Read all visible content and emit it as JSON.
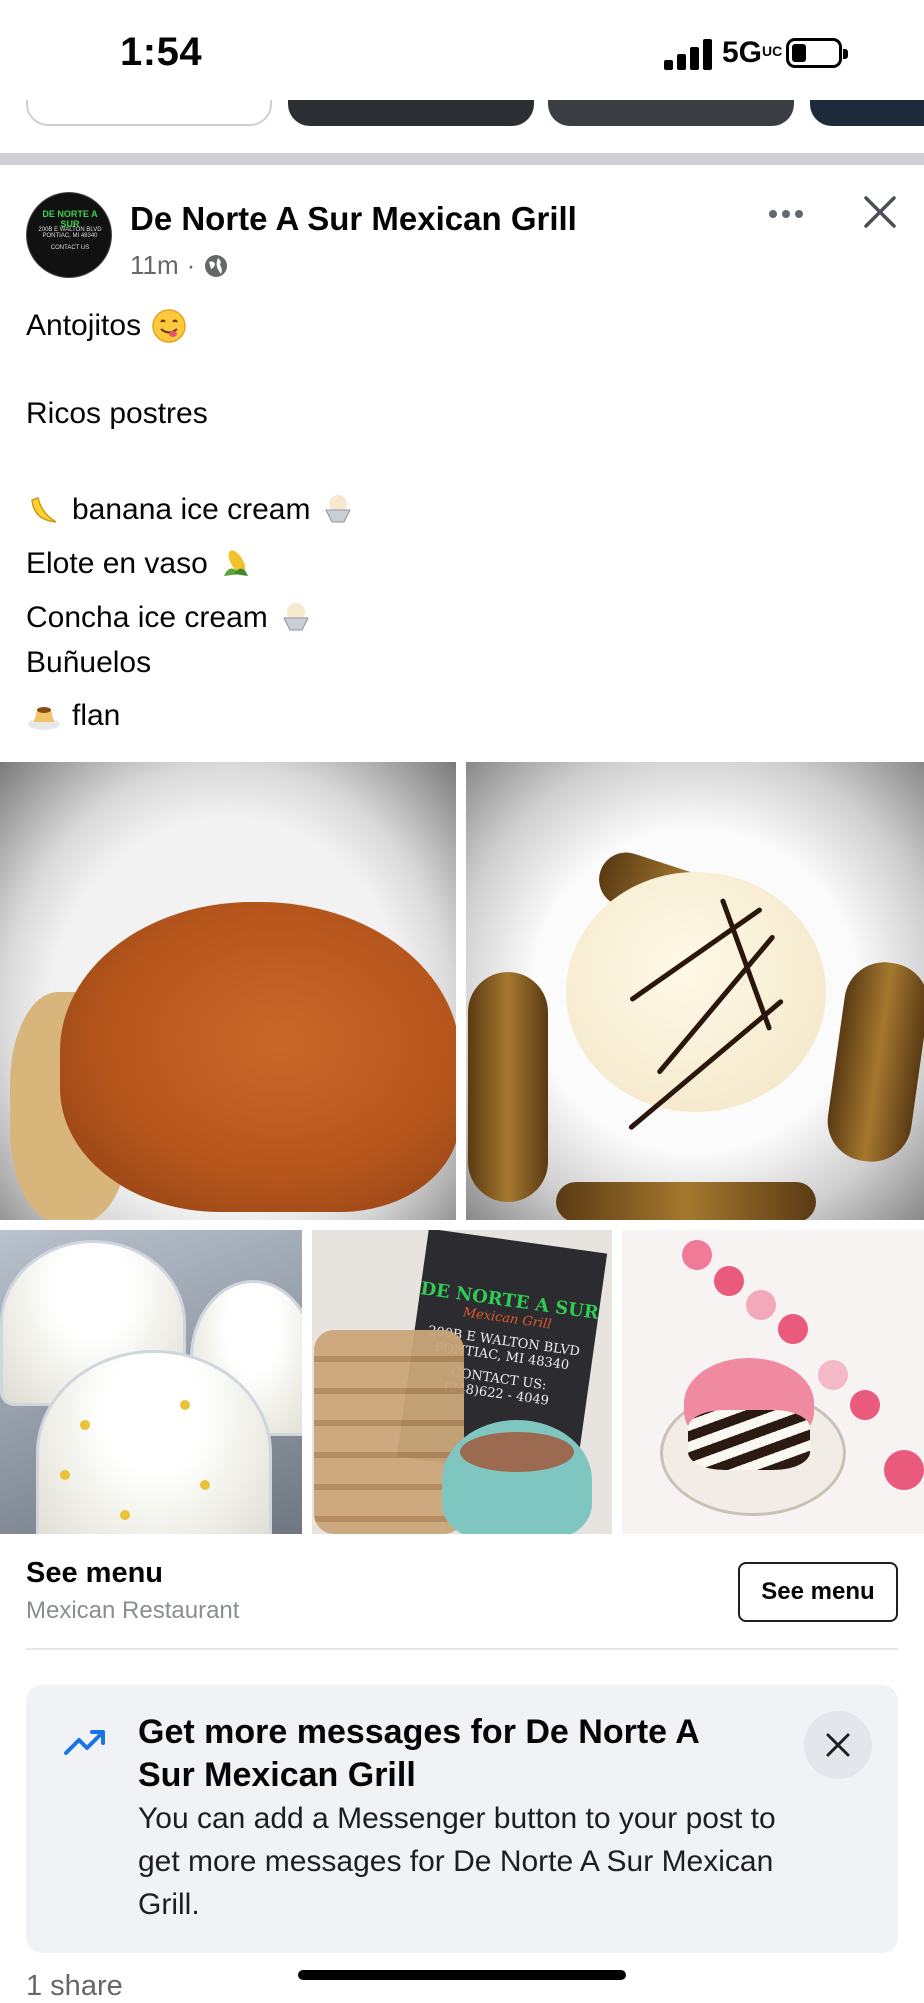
{
  "status_bar": {
    "time": "1:54",
    "network": "5G",
    "network_badge": "UC"
  },
  "post": {
    "author": "De Norte A Sur Mexican Grill",
    "avatar_text": [
      "DE NORTE A SUR",
      "200B E WALTON BLVD PONTIAC, MI 48340",
      "CONTACT US"
    ],
    "time": "11m",
    "separator": "·",
    "lines": [
      {
        "text": "Antojitos",
        "emoji": "savoring-face"
      },
      {
        "text": "Ricos postres"
      },
      {
        "text": "banana ice cream",
        "prefix_emoji": "banana",
        "emoji": "ice-cream-cup"
      },
      {
        "text": "Elote en vaso",
        "emoji": "corn"
      },
      {
        "text": "Concha ice cream",
        "emoji": "ice-cream-cup"
      },
      {
        "text": "Buñuelos"
      },
      {
        "text": "flan",
        "prefix_emoji": "custard"
      }
    ],
    "photo_card_text": [
      "DE NORTE A SUR",
      "Mexican Grill",
      "200B E WALTON BLVD",
      "PONTIAC, MI 48340",
      "CONTACT US:",
      "(248)622 - 4049"
    ]
  },
  "cta": {
    "title": "See menu",
    "subtitle": "Mexican Restaurant",
    "button": "See menu"
  },
  "promo": {
    "title": "Get more messages for De Norte A Sur Mexican Grill",
    "body": "You can add a Messenger button to your post to get more messages for De Norte A Sur Mexican Grill."
  },
  "footer": {
    "shares": "1 share"
  },
  "colors": {
    "text": "#050505",
    "secondary": "#65676b",
    "promo_bg": "#f0f2f5",
    "accent": "#1b74e4",
    "separator": "#ced0d4"
  }
}
